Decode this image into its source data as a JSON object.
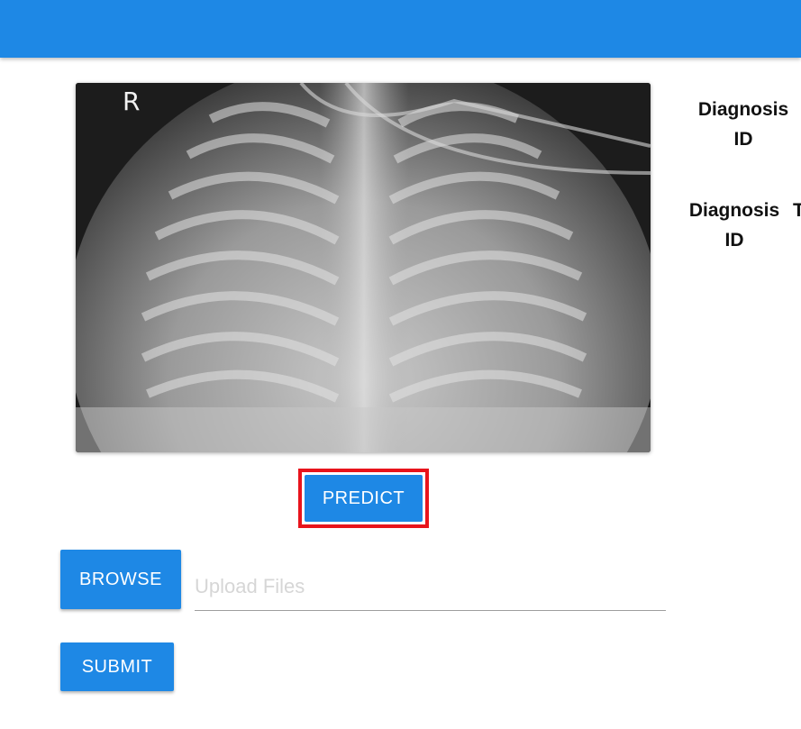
{
  "image": {
    "marker_letter": "R"
  },
  "buttons": {
    "predict": "PREDICT",
    "browse": "BROWSE",
    "submit": "SUBMIT"
  },
  "upload": {
    "placeholder": "Upload Files",
    "value": ""
  },
  "results": {
    "diagnosis_id_1": {
      "line1": "Diagnosis",
      "line2": "ID"
    },
    "diagnosis_id_2": {
      "line1": "Diagnosis",
      "line2": "ID",
      "extra": "T"
    }
  },
  "colors": {
    "primary": "#1e88e5",
    "highlight": "#e8141c"
  }
}
